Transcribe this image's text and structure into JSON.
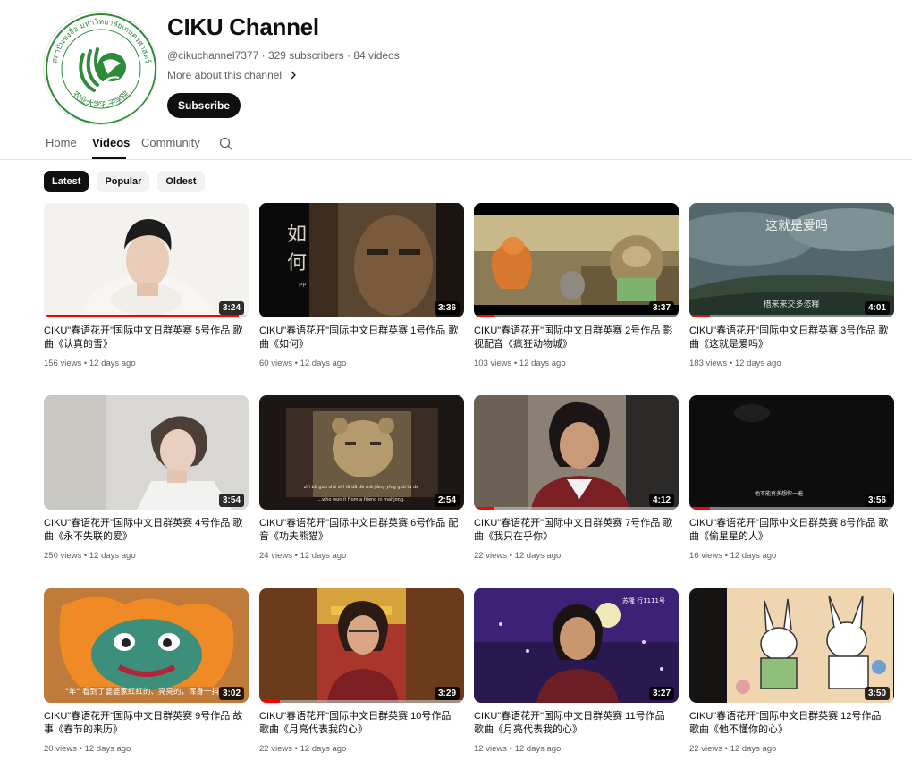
{
  "channel": {
    "name": "CIKU Channel",
    "handle": "@cikuchannel7377",
    "subscribers": "329 subscribers",
    "videos_count": "84 videos",
    "separator": "·",
    "about_label": "More about this channel",
    "subscribe_label": "Subscribe",
    "logo_top_text": "สถาบันขงจื่อ มหาวิทยาลัยเกษตรศาสตร์",
    "logo_bottom_text": "农业大学孔子学院",
    "logo_color": "#2e8b3a"
  },
  "tabs": [
    {
      "label": "Home"
    },
    {
      "label": "Videos"
    },
    {
      "label": "Community"
    }
  ],
  "chips": [
    {
      "label": "Latest"
    },
    {
      "label": "Popular"
    },
    {
      "label": "Oldest"
    }
  ],
  "videos": [
    {
      "title": "CIKU\"春语花开\"国际中文日群英赛 5号作品 歌曲《认真的雪》",
      "views": "156 views",
      "age": "12 days ago",
      "duration": "3:24",
      "watched": 0.95
    },
    {
      "title": "CIKU\"春语花开\"国际中文日群英赛 1号作品 歌曲《如何》",
      "views": "60 views",
      "age": "12 days ago",
      "duration": "3:36",
      "watched": 0.0,
      "overlay": "如\n何"
    },
    {
      "title": "CIKU\"春语花开\"国际中文日群英赛 2号作品 影视配音《疯狂动物城》",
      "views": "103 views",
      "age": "12 days ago",
      "duration": "3:37",
      "watched": 0.1
    },
    {
      "title": "CIKU\"春语花开\"国际中文日群英赛 3号作品 歌曲《这就是爱吗》",
      "views": "183 views",
      "age": "12 days ago",
      "duration": "4:01",
      "watched": 0.1,
      "overlay": "这就是爱吗"
    },
    {
      "title": "CIKU\"春语花开\"国际中文日群英赛 4号作品 歌曲《永不失联的爱》",
      "views": "250 views",
      "age": "12 days ago",
      "duration": "3:54",
      "watched": 0.0
    },
    {
      "title": "CIKU\"春语花开\"国际中文日群英赛 6号作品 配音《功夫熊猫》",
      "views": "24 views",
      "age": "12 days ago",
      "duration": "2:54",
      "watched": 0.0
    },
    {
      "title": "CIKU\"春语花开\"国际中文日群英赛 7号作品 歌曲《我只在乎你》",
      "views": "22 views",
      "age": "12 days ago",
      "duration": "4:12",
      "watched": 0.1
    },
    {
      "title": "CIKU\"春语花开\"国际中文日群英赛 8号作品 歌曲《偷星星的人》",
      "views": "16 views",
      "age": "12 days ago",
      "duration": "3:56",
      "watched": 0.1
    },
    {
      "title": "CIKU\"春语花开\"国际中文日群英赛 9号作品 故事《春节的来历》",
      "views": "20 views",
      "age": "12 days ago",
      "duration": "3:02",
      "watched": 0.0,
      "overlay": "\"年\" 看到了婆婆家红红的、亮亮的，浑身一抖"
    },
    {
      "title": "CIKU\"春语花开\"国际中文日群英赛 10号作品 歌曲《月亮代表我的心》",
      "views": "22 views",
      "age": "12 days ago",
      "duration": "3:29",
      "watched": 0.1
    },
    {
      "title": "CIKU\"春语花开\"国际中文日群英赛 11号作品 歌曲《月亮代表我的心》",
      "views": "12 views",
      "age": "12 days ago",
      "duration": "3:27",
      "watched": 0.0
    },
    {
      "title": "CIKU\"春语花开\"国际中文日群英赛 12号作品 歌曲《他不懂你的心》",
      "views": "22 views",
      "age": "12 days ago",
      "duration": "3:50",
      "watched": 0.0
    }
  ]
}
